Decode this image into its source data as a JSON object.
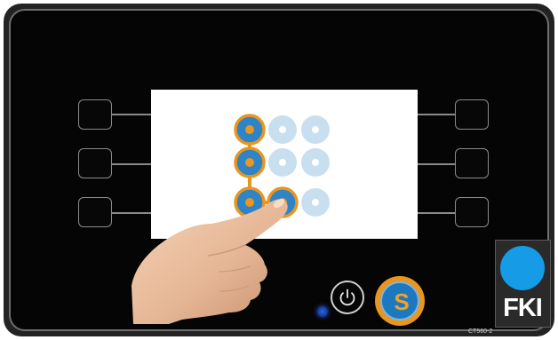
{
  "device": {
    "model_label": "CT560-2",
    "brand_logo_text": "FKI"
  },
  "screen": {
    "content": "pattern-lock",
    "grid_rows": 3,
    "grid_cols": 3,
    "selected_pattern": [
      1,
      4,
      7,
      8
    ],
    "selected_color": "#e8961f",
    "idle_color": "#c8dff0",
    "selected_fill": "#2e84c6"
  },
  "soft_keys": {
    "left": [
      "",
      "",
      ""
    ],
    "right": [
      "",
      "",
      ""
    ]
  },
  "controls": {
    "power_icon": "power-icon",
    "s_button_label": "S",
    "indicator_color": "#2b66e8"
  },
  "colors": {
    "panel": "#050505",
    "bezel": "#232323",
    "accent_orange": "#e8961f",
    "accent_blue": "#1c78bf",
    "logo_blue": "#169be6"
  }
}
